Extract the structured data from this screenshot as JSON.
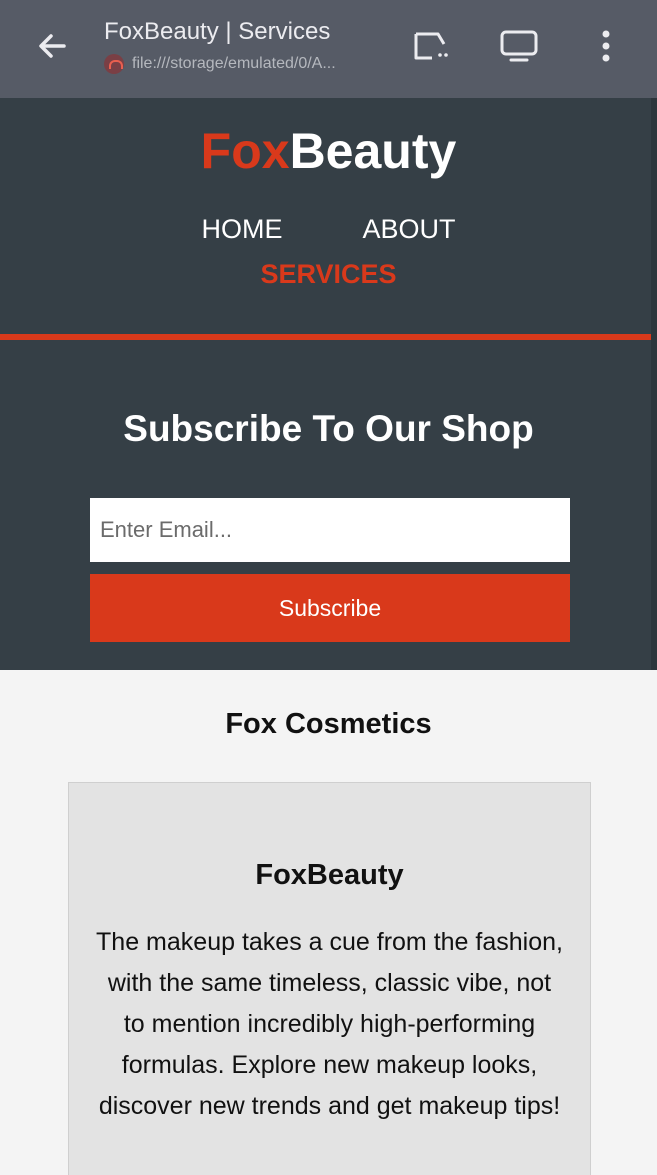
{
  "browser": {
    "page_title": "FoxBeauty | Services",
    "url": "file:///storage/emulated/0/A..."
  },
  "site": {
    "logo_fox": "Fox",
    "logo_beauty": "Beauty",
    "nav": {
      "home": "HOME",
      "about": "ABOUT",
      "services": "SERVICES"
    },
    "subscribe": {
      "title": "Subscribe To Our Shop",
      "email_placeholder": "Enter Email...",
      "button": "Subscribe"
    },
    "section_title": "Fox Cosmetics",
    "card": {
      "title": "FoxBeauty",
      "text": "The makeup takes a cue from the fashion, with the same timeless, classic vibe, not to mention incredibly high-performing formulas. Explore new makeup looks, discover new trends and get makeup tips!"
    }
  },
  "colors": {
    "chrome_bg": "#565b66",
    "header_bg": "#353f46",
    "accent": "#d9391b",
    "page_bg": "#f4f4f4",
    "card_bg": "#e3e3e3"
  },
  "icons": [
    "back-arrow-icon",
    "reader-mode-icon",
    "desktop-site-icon",
    "more-vert-icon",
    "site-favicon"
  ]
}
